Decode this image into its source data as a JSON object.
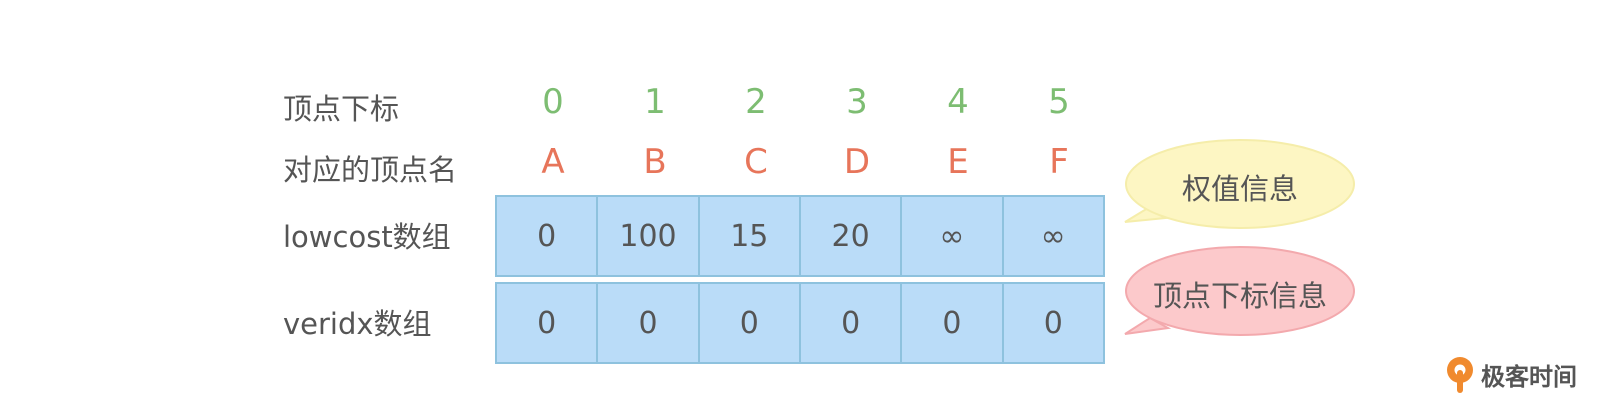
{
  "labels": {
    "index_row": "顶点下标",
    "name_row": "对应的顶点名",
    "lowcost_row": "lowcost数组",
    "veridx_row": "veridx数组"
  },
  "indices": [
    "0",
    "1",
    "2",
    "3",
    "4",
    "5"
  ],
  "vertex_names": [
    "A",
    "B",
    "C",
    "D",
    "E",
    "F"
  ],
  "lowcost": [
    "0",
    "100",
    "15",
    "20",
    "∞",
    "∞"
  ],
  "veridx": [
    "0",
    "0",
    "0",
    "0",
    "0",
    "0"
  ],
  "callouts": {
    "weight": "权值信息",
    "index": "顶点下标信息"
  },
  "logo": {
    "text": "极客时间",
    "icon": "geektime-logo-icon"
  },
  "colors": {
    "index_text": "#7dbd72",
    "name_text": "#e7755a",
    "cell_fill": "#badcf8",
    "cell_border": "#8ec2de",
    "weight_bubble": "#fdf6c3",
    "index_bubble": "#fcc9cb",
    "logo_orange": "#f08a2e"
  }
}
